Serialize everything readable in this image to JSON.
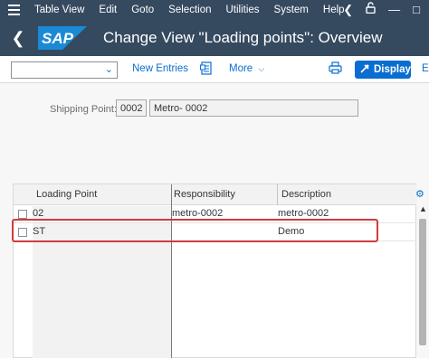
{
  "menubar": {
    "items": [
      "Table View",
      "Edit",
      "Goto",
      "Selection",
      "Utilities",
      "System",
      "Help"
    ]
  },
  "titlebar": {
    "logo_text": "SAP",
    "title": "Change View \"Loading points\": Overview"
  },
  "toolbar": {
    "select_value": "",
    "new_entries_label": "New Entries",
    "more_label": "More",
    "display_label": "Display",
    "overflow_label": "E"
  },
  "shipping": {
    "label": "Shipping Point:",
    "code": "0002",
    "description": "Metro- 0002"
  },
  "table": {
    "columns": [
      "Loading Point",
      "Responsibility",
      "Description"
    ],
    "rows": [
      {
        "loading_point": "02",
        "responsibility": "metro-0002",
        "description": "metro-0002"
      },
      {
        "loading_point": "ST",
        "responsibility": "",
        "description": "Demo"
      }
    ]
  },
  "colors": {
    "shell": "#354a5f",
    "accent": "#0a6ed1",
    "highlight_border": "#cf3c3c"
  }
}
